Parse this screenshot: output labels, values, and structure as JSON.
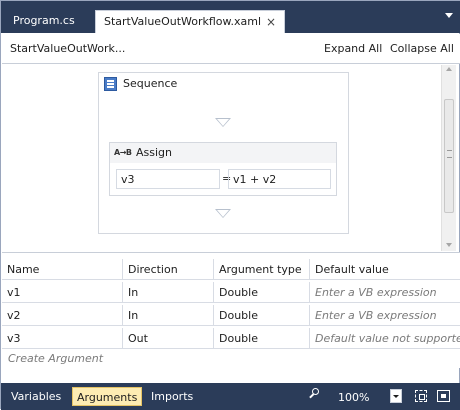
{
  "tabs": [
    {
      "label": "Program.cs",
      "active": false
    },
    {
      "label": "StartValueOutWorkflow.xaml",
      "active": true
    }
  ],
  "tab_close_glyph": "×",
  "breadcrumb": "StartValueOutWork...",
  "toolbar": {
    "expand_all": "Expand All",
    "collapse_all": "Collapse All"
  },
  "sequence": {
    "label": "Sequence",
    "icon": "sequence-icon"
  },
  "assign": {
    "icon_text": "A→B",
    "label": "Assign",
    "to": "v3",
    "equals": "=",
    "value": "v1 + v2"
  },
  "arguments_grid": {
    "columns": [
      "Name",
      "Direction",
      "Argument type",
      "Default value"
    ],
    "rows": [
      {
        "name": "v1",
        "direction": "In",
        "type": "Double",
        "default": "Enter a VB expression"
      },
      {
        "name": "v2",
        "direction": "In",
        "type": "Double",
        "default": "Enter a VB expression"
      },
      {
        "name": "v3",
        "direction": "Out",
        "type": "Double",
        "default": "Default value not supported"
      }
    ],
    "create_label": "Create Argument"
  },
  "bottom_tabs": {
    "variables": "Variables",
    "arguments": "Arguments",
    "imports": "Imports",
    "active": "Arguments"
  },
  "zoom": {
    "level": "100%"
  },
  "icons": [
    "sequence-icon",
    "assign-icon",
    "close-icon",
    "dropdown-icon",
    "zoom-icon",
    "fit-to-screen-icon",
    "overview-icon"
  ],
  "colors": {
    "chrome": "#2b3c59",
    "active_bottom_tab": "#fdecb3"
  }
}
